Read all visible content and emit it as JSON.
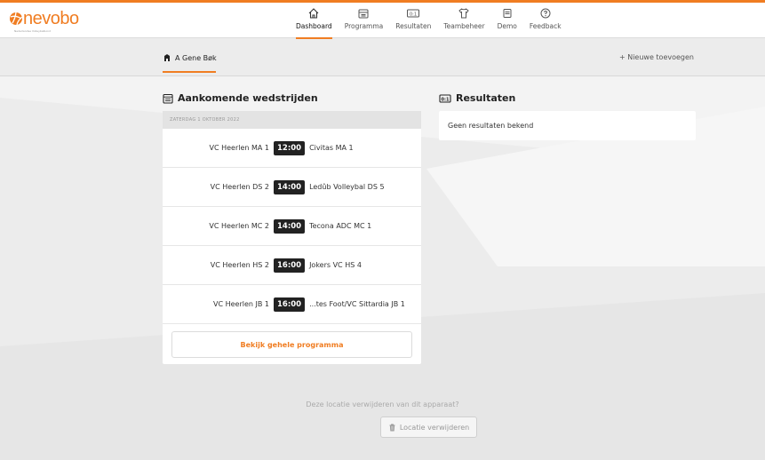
{
  "brand": {
    "name": "nevobo",
    "tagline": "Nederlandse Volleybalbond",
    "accent": "#f07d22"
  },
  "nav": {
    "items": [
      {
        "label": "Dashboard",
        "icon": "home-icon",
        "active": true
      },
      {
        "label": "Programma",
        "icon": "calendar-icon",
        "active": false
      },
      {
        "label": "Resultaten",
        "icon": "scoreboard-icon",
        "active": false
      },
      {
        "label": "Teambeheer",
        "icon": "shirt-icon",
        "active": false
      },
      {
        "label": "Demo",
        "icon": "demo-icon",
        "active": false
      },
      {
        "label": "Feedback",
        "icon": "question-icon",
        "active": false
      }
    ]
  },
  "location": {
    "name": "A Gene Bøk",
    "add_label": "+ Nieuwe toevoegen"
  },
  "upcoming": {
    "title": "Aankomende wedstrijden",
    "date_header": "ZATERDAG 1 OKTOBER 2022",
    "matches": [
      {
        "home": "VC Heerlen MA 1",
        "time": "12:00",
        "away": "Civitas MA 1"
      },
      {
        "home": "VC Heerlen DS 2",
        "time": "14:00",
        "away": "Ledûb Volleybal DS 5"
      },
      {
        "home": "VC Heerlen MC 2",
        "time": "14:00",
        "away": "Tecona ADC MC 1"
      },
      {
        "home": "VC Heerlen HS 2",
        "time": "16:00",
        "away": "Jokers VC HS 4"
      },
      {
        "home": "VC Heerlen JB 1",
        "time": "16:00",
        "away": "...tes Foot/VC Sittardia JB 1"
      }
    ],
    "program_button": "Bekijk gehele programma"
  },
  "results": {
    "title": "Resultaten",
    "empty": "Geen resultaten bekend"
  },
  "footer": {
    "question": "Deze locatie verwijderen van dit apparaat?",
    "remove_button": "Locatie verwijderen"
  }
}
